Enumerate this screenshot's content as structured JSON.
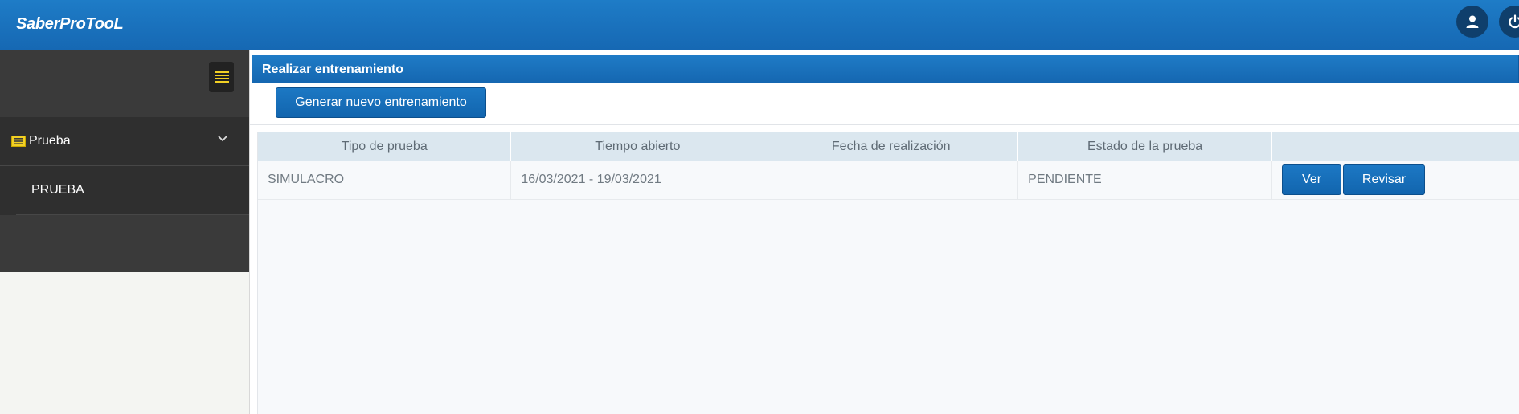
{
  "app": {
    "brand": "SaberProTooL"
  },
  "topbar": {
    "user_icon": "user-icon",
    "power_icon": "power-icon"
  },
  "sidebar": {
    "toggle_icon": "menu-icon",
    "menu": {
      "label": "Prueba",
      "icon": "list-icon",
      "expanded": true,
      "items": [
        {
          "label": "PRUEBA"
        }
      ]
    }
  },
  "panel": {
    "title": "Realizar entrenamiento",
    "generate_button": "Generar nuevo entrenamiento"
  },
  "table": {
    "columns": [
      "Tipo de prueba",
      "Tiempo abierto",
      "Fecha de realización",
      "Estado de la prueba",
      ""
    ],
    "rows": [
      {
        "tipo": "SIMULACRO",
        "tiempo": "16/03/2021 - 19/03/2021",
        "fecha": "",
        "estado": "PENDIENTE",
        "actions": [
          "Ver",
          "Revisar"
        ]
      }
    ]
  },
  "colors": {
    "primary": "#1668b3",
    "sidebar": "#3a3a3a",
    "accent_icon": "#f2d024"
  }
}
